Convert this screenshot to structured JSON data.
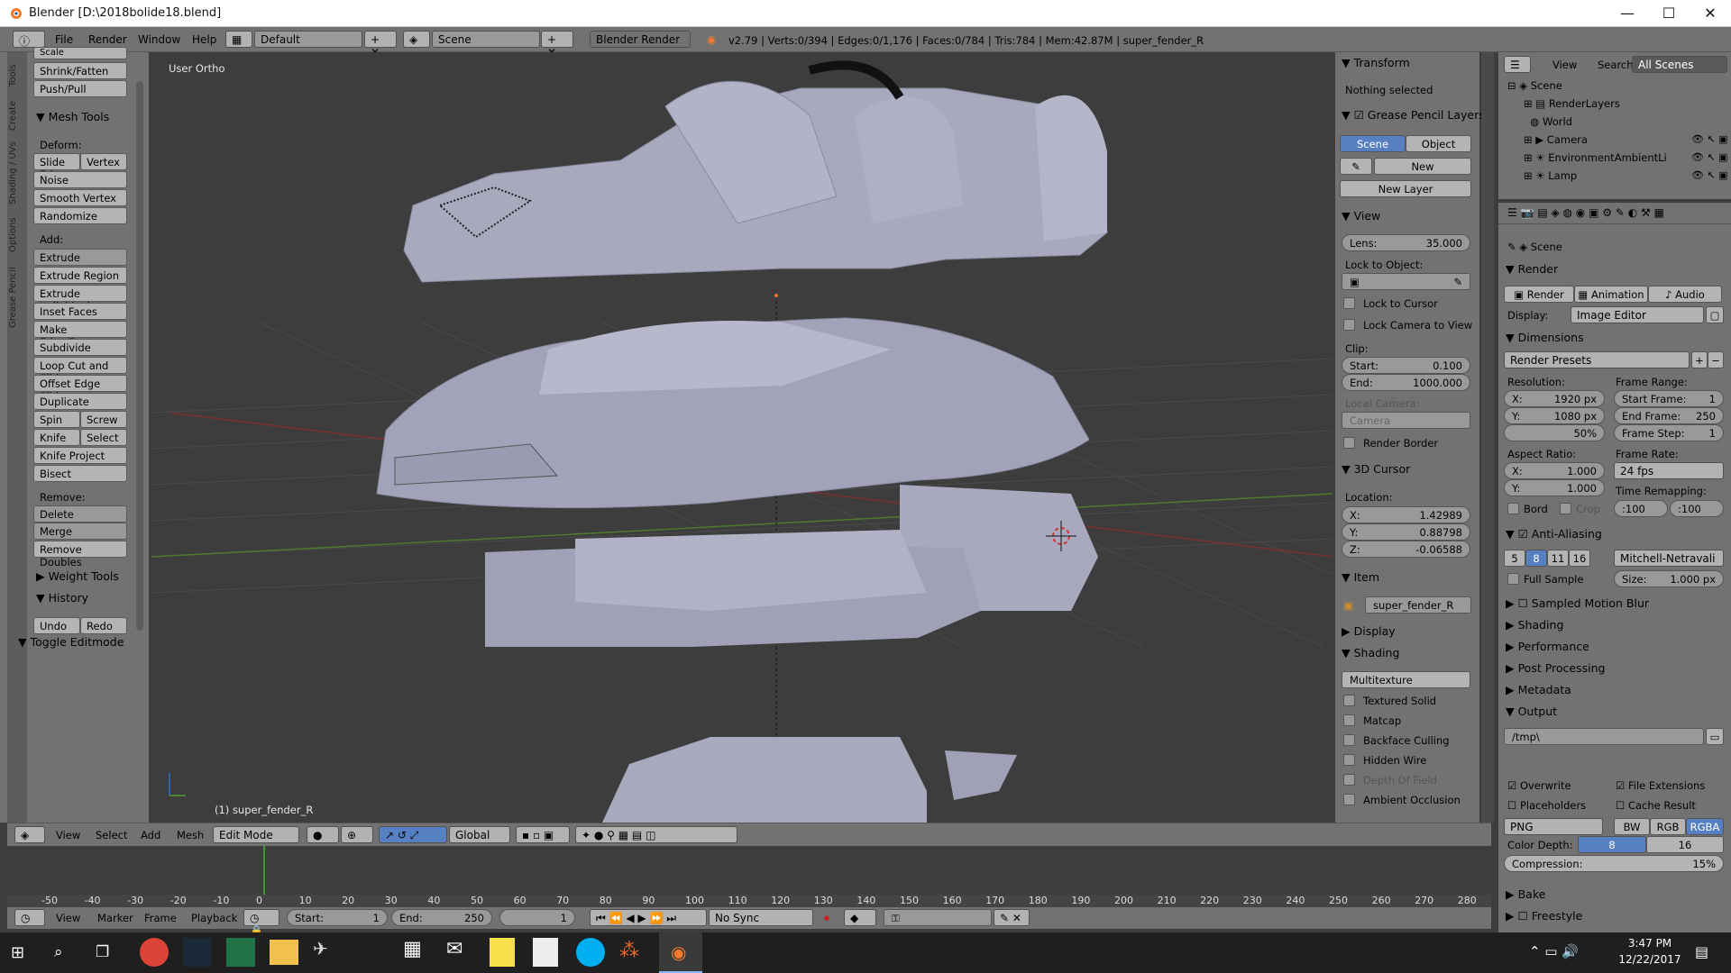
{
  "window": {
    "title": "Blender [D:\\2018bolide18.blend]",
    "min": "—",
    "max": "☐",
    "close": "✕"
  },
  "menu": {
    "items": [
      "File",
      "Render",
      "Window",
      "Help"
    ],
    "layout": "Default",
    "scene": "Scene",
    "engine": "Blender Render",
    "stats": "v2.79 | Verts:0/394 | Edges:0/1,176 | Faces:0/784 | Tris:784 | Mem:42.87M | super_fender_R"
  },
  "tools": {
    "tabs": [
      "Tools",
      "Create",
      "Shading / UVs",
      "Options",
      "Grease Pencil"
    ],
    "top_buttons": [
      "Scale",
      "Shrink/Fatten",
      "Push/Pull"
    ],
    "mesh_tools": "Mesh Tools",
    "deform_label": "Deform:",
    "slide_edge": "Slide Ed",
    "vertex": "Vertex",
    "noise": "Noise",
    "smooth_vertex": "Smooth Vertex",
    "randomize": "Randomize",
    "add_label": "Add:",
    "extrude": "Extrude",
    "add_buttons": [
      "Extrude Region",
      "Extrude Individual",
      "Inset Faces",
      "Make Edge/Face",
      "Subdivide",
      "Loop Cut and Slide",
      "Offset Edge Slide",
      "Duplicate"
    ],
    "spin": "Spin",
    "screw": "Screw",
    "knife": "Knife",
    "select": "Select",
    "knife_project": "Knife Project",
    "bisect": "Bisect",
    "remove_label": "Remove:",
    "delete": "Delete",
    "merge": "Merge",
    "remove_doubles": "Remove Doubles",
    "weight_tools": "Weight Tools",
    "history": "History",
    "undo": "Undo",
    "redo": "Redo",
    "toggle_editmode": "Toggle Editmode"
  },
  "viewport": {
    "view_name": "User Ortho",
    "object_label": "(1) super_fender_R"
  },
  "props": {
    "transform": "Transform",
    "nothing_selected": "Nothing selected",
    "grease_pencil": "Grease Pencil Layers",
    "scene_btn": "Scene",
    "object_btn": "Object",
    "new_btn": "New",
    "new_layer": "New Layer",
    "view": "View",
    "lens_label": "Lens:",
    "lens_value": "35.000",
    "lock_to_object": "Lock to Object:",
    "lock_to_cursor": "Lock to Cursor",
    "lock_camera": "Lock Camera to View",
    "clip": "Clip:",
    "start_label": "Start:",
    "start_value": "0.100",
    "end_label": "End:",
    "end_value": "1000.000",
    "local_camera": "Local Camera:",
    "camera": "Camera",
    "render_border": "Render Border",
    "cursor": "3D Cursor",
    "location": "Location:",
    "x_label": "X:",
    "x_value": "1.42989",
    "y_label": "Y:",
    "y_value": "0.88798",
    "z_label": "Z:",
    "z_value": "-0.06588",
    "item": "Item",
    "item_name": "super_fender_R",
    "display": "Display",
    "shading": "Shading",
    "shading_mode": "Multitexture",
    "shading_opts": [
      "Textured Solid",
      "Matcap",
      "Backface Culling",
      "Hidden Wire",
      "Depth Of Field",
      "Ambient Occlusion"
    ]
  },
  "outliner": {
    "view": "View",
    "search": "Search",
    "filter": "All Scenes",
    "items": [
      "Scene",
      "RenderLayers",
      "World",
      "Camera",
      "EnvironmentAmbientLi",
      "Lamp"
    ]
  },
  "render": {
    "scene": "Scene",
    "render_sec": "Render",
    "render_btn": "Render",
    "animation_btn": "Animation",
    "audio_btn": "Audio",
    "display_label": "Display:",
    "display_value": "Image Editor",
    "dimensions": "Dimensions",
    "presets": "Render Presets",
    "resolution": "Resolution:",
    "res_x": "X:",
    "res_x_val": "1920 px",
    "res_y": "Y:",
    "res_y_val": "1080 px",
    "res_pct": "50%",
    "frame_range": "Frame Range:",
    "start_frame": "Start Frame:",
    "start_frame_val": "1",
    "end_frame": "End Frame:",
    "end_frame_val": "250",
    "frame_step": "Frame Step:",
    "frame_step_val": "1",
    "aspect": "Aspect Ratio:",
    "asp_x": "X:",
    "asp_x_val": "1.000",
    "asp_y": "Y:",
    "asp_y_val": "1.000",
    "frame_rate": "Frame Rate:",
    "fps": "24 fps",
    "time_remap": "Time Remapping:",
    "remap_old": ":100",
    "remap_new": ":100",
    "bord": "Bord",
    "crop": "Crop",
    "anti_aliasing": "Anti-Aliasing",
    "aa_samples": [
      "5",
      "8",
      "11",
      "16"
    ],
    "aa_filter": "Mitchell-Netravali",
    "full_sample": "Full Sample",
    "size_label": "Size:",
    "size_value": "1.000 px",
    "collapsed": [
      "Sampled Motion Blur",
      "Shading",
      "Performance",
      "Post Processing",
      "Metadata"
    ],
    "output": "Output",
    "path": "/tmp\\",
    "overwrite": "Overwrite",
    "file_ext": "File Extensions",
    "placeholders": "Placeholders",
    "cache_result": "Cache Result",
    "format": "PNG",
    "bw": "BW",
    "rgb": "RGB",
    "rgba": "RGBA",
    "color_depth": "Color Depth:",
    "depth_8": "8",
    "depth_16": "16",
    "compression": "Compression:",
    "compression_val": "15%",
    "bake": "Bake",
    "freestyle": "Freestyle"
  },
  "view3d_header": {
    "view": "View",
    "select": "Select",
    "add": "Add",
    "mesh": "Mesh",
    "mode": "Edit Mode",
    "orientation": "Global"
  },
  "timeline": {
    "ticks": [
      "-50",
      "-40",
      "-30",
      "-20",
      "-10",
      "0",
      "10",
      "20",
      "30",
      "40",
      "50",
      "60",
      "70",
      "80",
      "90",
      "100",
      "110",
      "120",
      "130",
      "140",
      "150",
      "160",
      "170",
      "180",
      "190",
      "200",
      "210",
      "220",
      "230",
      "240",
      "250",
      "260",
      "270",
      "280"
    ],
    "view": "View",
    "marker": "Marker",
    "frame": "Frame",
    "playback": "Playback",
    "start_label": "Start:",
    "start": "1",
    "end_label": "End:",
    "end": "250",
    "current": "1",
    "sync": "No Sync"
  },
  "taskbar": {
    "time": "3:47 PM",
    "date": "12/22/2017"
  }
}
